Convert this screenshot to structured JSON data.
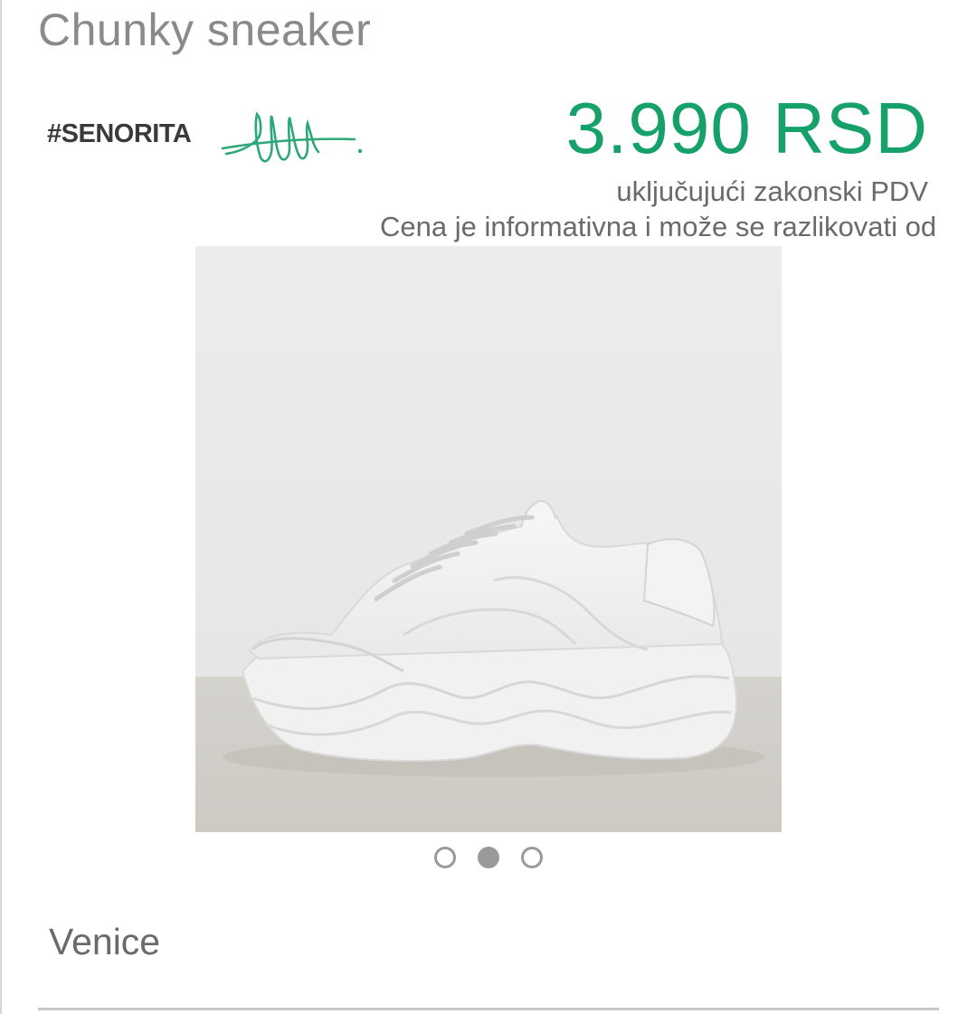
{
  "product": {
    "title": "Chunky sneaker",
    "brand": "#SENORITA",
    "price": "3.990 RSD",
    "vat_note": "uključujući zakonski PDV",
    "info_note": "Cena je informativna i može se razlikovati od",
    "color_name": "Venice"
  },
  "gallery": {
    "image_icon": "white-chunky-sneaker-photo",
    "dots": [
      {
        "active": false
      },
      {
        "active": true
      },
      {
        "active": false
      }
    ]
  },
  "colors": {
    "price": "#16a06a",
    "signature": "#2fa878",
    "title": "#8a8a8a",
    "text": "#6a6a6a"
  }
}
